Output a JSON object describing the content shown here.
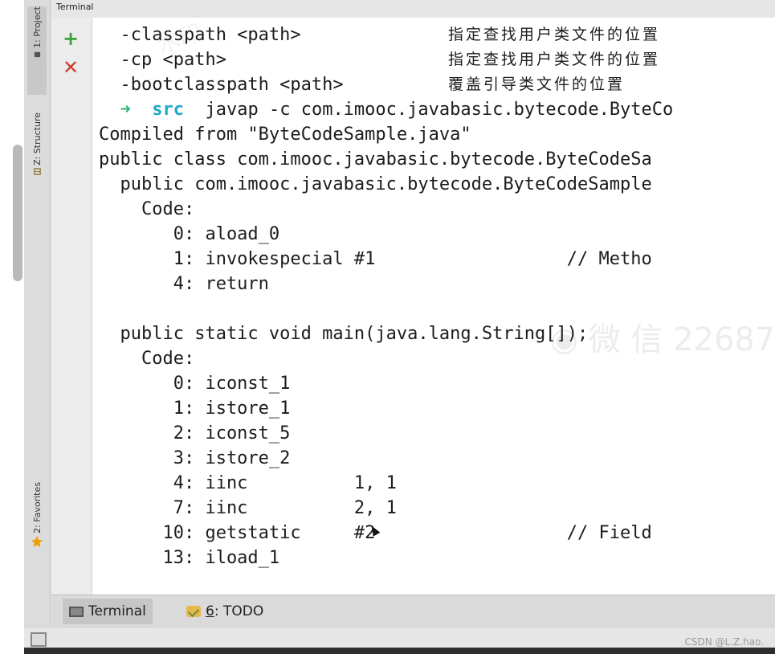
{
  "window": {
    "header_title": "Terminal"
  },
  "side_tabs": {
    "project": "1: Project",
    "structure": "Z: Structure",
    "favorites": "2: Favorites"
  },
  "terminal": {
    "help_lines": [
      {
        "option": "  -classpath <path>",
        "desc": "指定查找用户类文件的位置"
      },
      {
        "option": "  -cp <path>",
        "desc": "指定查找用户类文件的位置"
      },
      {
        "option": "  -bootclasspath <path>",
        "desc": "覆盖引导类文件的位置"
      }
    ],
    "prompt": {
      "arrow": "➜",
      "dir": "src",
      "command": "javap -c com.imooc.javabasic.bytecode.ByteCo"
    },
    "output_lines": [
      "Compiled from \"ByteCodeSample.java\"",
      "public class com.imooc.javabasic.bytecode.ByteCodeSa",
      "  public com.imooc.javabasic.bytecode.ByteCodeSample",
      "    Code:",
      "       0: aload_0",
      "       1: invokespecial #1                  // Metho",
      "       4: return",
      "",
      "  public static void main(java.lang.String[]);",
      "    Code:",
      "       0: iconst_1",
      "       1: istore_1",
      "       2: iconst_5",
      "       3: istore_2",
      "       4: iinc          1, 1",
      "       7: iinc          2, 1",
      "      10: getstatic     #2                  // Field",
      "      13: iload_1"
    ]
  },
  "bottom_tabs": {
    "terminal": "Terminal",
    "todo_prefix": "6",
    "todo_suffix": ": TODO"
  },
  "status": {
    "credit": "CSDN @L.Z.hao."
  },
  "colors": {
    "prompt_arrow": "#2bb673",
    "prompt_dir": "#1fa8c9",
    "add_icon": "#3ca23c",
    "close_icon": "#d23a2a"
  }
}
